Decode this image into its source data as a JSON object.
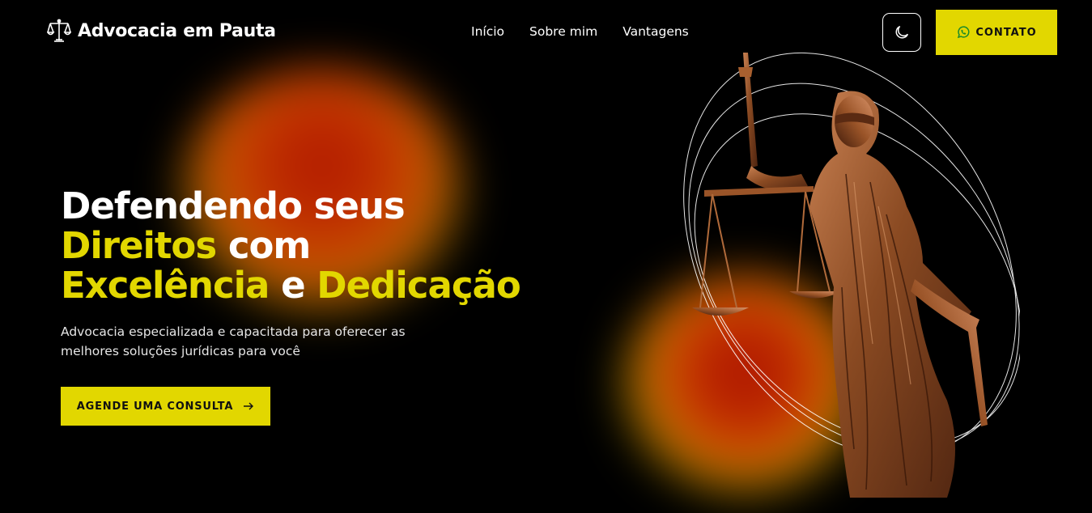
{
  "brand": {
    "name": "Advocacia em Pauta",
    "icon": "scales-icon"
  },
  "nav": {
    "items": [
      {
        "label": "Início"
      },
      {
        "label": "Sobre mim"
      },
      {
        "label": "Vantagens"
      }
    ]
  },
  "header": {
    "theme_icon": "moon-icon",
    "contact_label": "CONTATO",
    "contact_icon": "whatsapp-icon"
  },
  "hero": {
    "line1": "Defendendo seus",
    "line2_highlight": "Direitos",
    "line2_rest": "com",
    "line3_highlight1": "Excelência",
    "line3_mid": "e",
    "line3_highlight2": "Dedicação",
    "subtitle": "Advocacia especializada e capacitada para oferecer as melhores soluções jurídicas para você",
    "cta_label": "AGENDE UMA CONSULTA",
    "cta_icon": "arrow-right-icon"
  },
  "colors": {
    "accent": "#e2d700",
    "background": "#000000",
    "bronze": "#8a4a22"
  }
}
